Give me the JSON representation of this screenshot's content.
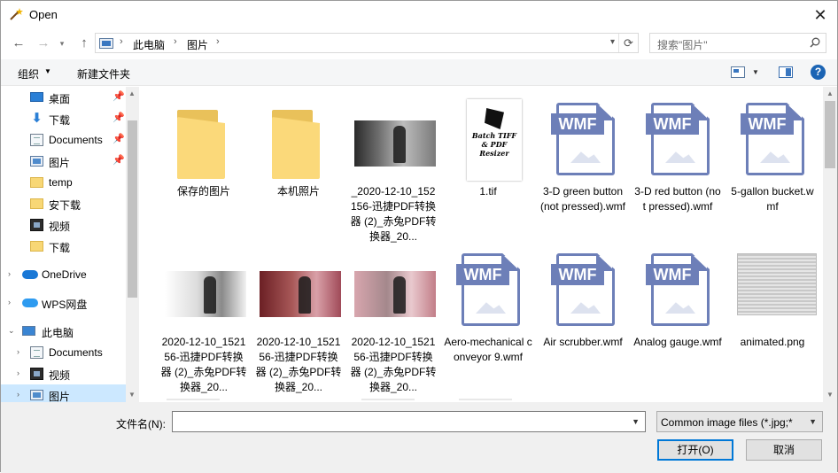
{
  "window": {
    "title": "Open"
  },
  "address": {
    "segments": [
      "此电脑",
      "图片"
    ]
  },
  "search": {
    "placeholder": "搜索\"图片\""
  },
  "toolbar": {
    "organize": "组织",
    "new_folder": "新建文件夹",
    "help": "?"
  },
  "sidebar": {
    "items": [
      {
        "label": "桌面",
        "icon": "desktop-icon",
        "pinned": true
      },
      {
        "label": "下载",
        "icon": "download-icon",
        "pinned": true
      },
      {
        "label": "Documents",
        "icon": "documents-icon",
        "pinned": true
      },
      {
        "label": "图片",
        "icon": "pictures-icon",
        "pinned": true
      },
      {
        "label": "temp",
        "icon": "folder-icon"
      },
      {
        "label": "安下载",
        "icon": "folder-icon"
      },
      {
        "label": "视频",
        "icon": "video-icon"
      },
      {
        "label": "下载",
        "icon": "folder-icon"
      },
      {
        "label": "OneDrive",
        "icon": "onedrive-icon"
      },
      {
        "label": "WPS网盘",
        "icon": "wps-cloud-icon"
      },
      {
        "label": "此电脑",
        "icon": "this-pc-icon"
      },
      {
        "label": "Documents",
        "icon": "documents-icon"
      },
      {
        "label": "视频",
        "icon": "video-icon"
      },
      {
        "label": "图片",
        "icon": "pictures-icon",
        "selected": true
      }
    ]
  },
  "files": [
    {
      "label": "保存的图片",
      "kind": "folder"
    },
    {
      "label": "本机照片",
      "kind": "folder"
    },
    {
      "label": "_2020-12-10_152156-迅捷PDF转换器 (2)_赤兔PDF转换器_20...",
      "kind": "photo-bw"
    },
    {
      "label": "1.tif",
      "kind": "tif"
    },
    {
      "label": "3-D green button (not pressed).wmf",
      "kind": "wmf"
    },
    {
      "label": "3-D red button (not pressed).wmf",
      "kind": "wmf"
    },
    {
      "label": "5-gallon bucket.wmf",
      "kind": "wmf"
    },
    {
      "label": "2020-12-10_152156-迅捷PDF转换器 (2)_赤兔PDF转换器_20...",
      "kind": "photo-white"
    },
    {
      "label": "2020-12-10_152156-迅捷PDF转换器 (2)_赤兔PDF转换器_20...",
      "kind": "photo-red"
    },
    {
      "label": "2020-12-10_152156-迅捷PDF转换器 (2)_赤兔PDF转换器_20...",
      "kind": "photo-pink"
    },
    {
      "label": "Aero-mechanical conveyor 9.wmf",
      "kind": "wmf"
    },
    {
      "label": "Air scrubber.wmf",
      "kind": "wmf"
    },
    {
      "label": "Analog gauge.wmf",
      "kind": "wmf"
    },
    {
      "label": "animated.png",
      "kind": "png"
    }
  ],
  "tif_preview_text": "Batch TIFF & PDF Resizer",
  "wmf_badge": "WMF",
  "bottom": {
    "filename_label": "文件名(N):",
    "filename_value": "",
    "filter": "Common image files (*.jpg;*",
    "open": "打开(O)",
    "cancel": "取消"
  }
}
